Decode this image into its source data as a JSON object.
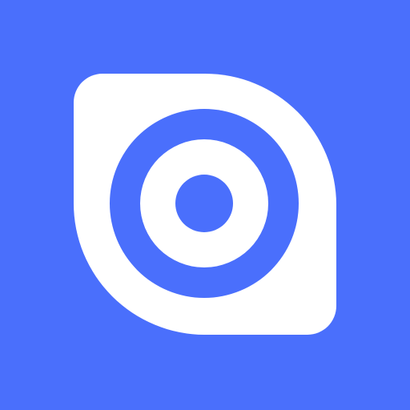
{
  "icon": {
    "name": "target-logo-icon",
    "colors": {
      "background": "#4a6ffc",
      "foreground": "#ffffff"
    }
  }
}
